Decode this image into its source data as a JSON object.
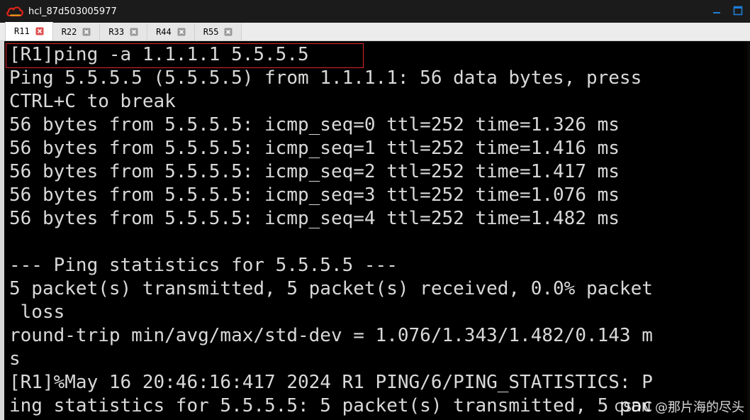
{
  "window": {
    "title": "hcl_87d503005977"
  },
  "tabs": [
    {
      "label": "R11",
      "active": true
    },
    {
      "label": "R22",
      "active": false
    },
    {
      "label": "R33",
      "active": false
    },
    {
      "label": "R44",
      "active": false
    },
    {
      "label": "R55",
      "active": false
    }
  ],
  "terminal": {
    "lines": [
      "[R1]ping -a 1.1.1.1 5.5.5.5",
      "Ping 5.5.5.5 (5.5.5.5) from 1.1.1.1: 56 data bytes, press",
      "CTRL+C to break",
      "56 bytes from 5.5.5.5: icmp_seq=0 ttl=252 time=1.326 ms",
      "56 bytes from 5.5.5.5: icmp_seq=1 ttl=252 time=1.416 ms",
      "56 bytes from 5.5.5.5: icmp_seq=2 ttl=252 time=1.417 ms",
      "56 bytes from 5.5.5.5: icmp_seq=3 ttl=252 time=1.076 ms",
      "56 bytes from 5.5.5.5: icmp_seq=4 ttl=252 time=1.482 ms",
      "",
      "--- Ping statistics for 5.5.5.5 ---",
      "5 packet(s) transmitted, 5 packet(s) received, 0.0% packet",
      " loss",
      "round-trip min/avg/max/std-dev = 1.076/1.343/1.482/0.143 m",
      "s",
      "[R1]%May 16 20:46:16:417 2024 R1 PING/6/PING_STATISTICS: P",
      "ing statistics for 5.5.5.5: 5 packet(s) transmitted, 5 pac"
    ]
  },
  "watermark": "CSDN @那片海的尽头",
  "colors": {
    "terminal_bg": "#000000",
    "terminal_fg": "#d9d9d9",
    "highlight": "#d8282b",
    "titlebar_bg": "#1b1b1b",
    "close_icon": "#e05050",
    "maximize_icon": "#1e7fd6"
  },
  "icons": {
    "app_logo": "cloud-icon",
    "minimize": "minimize-icon",
    "maximize": "maximize-icon",
    "tab_close": "close-icon"
  }
}
